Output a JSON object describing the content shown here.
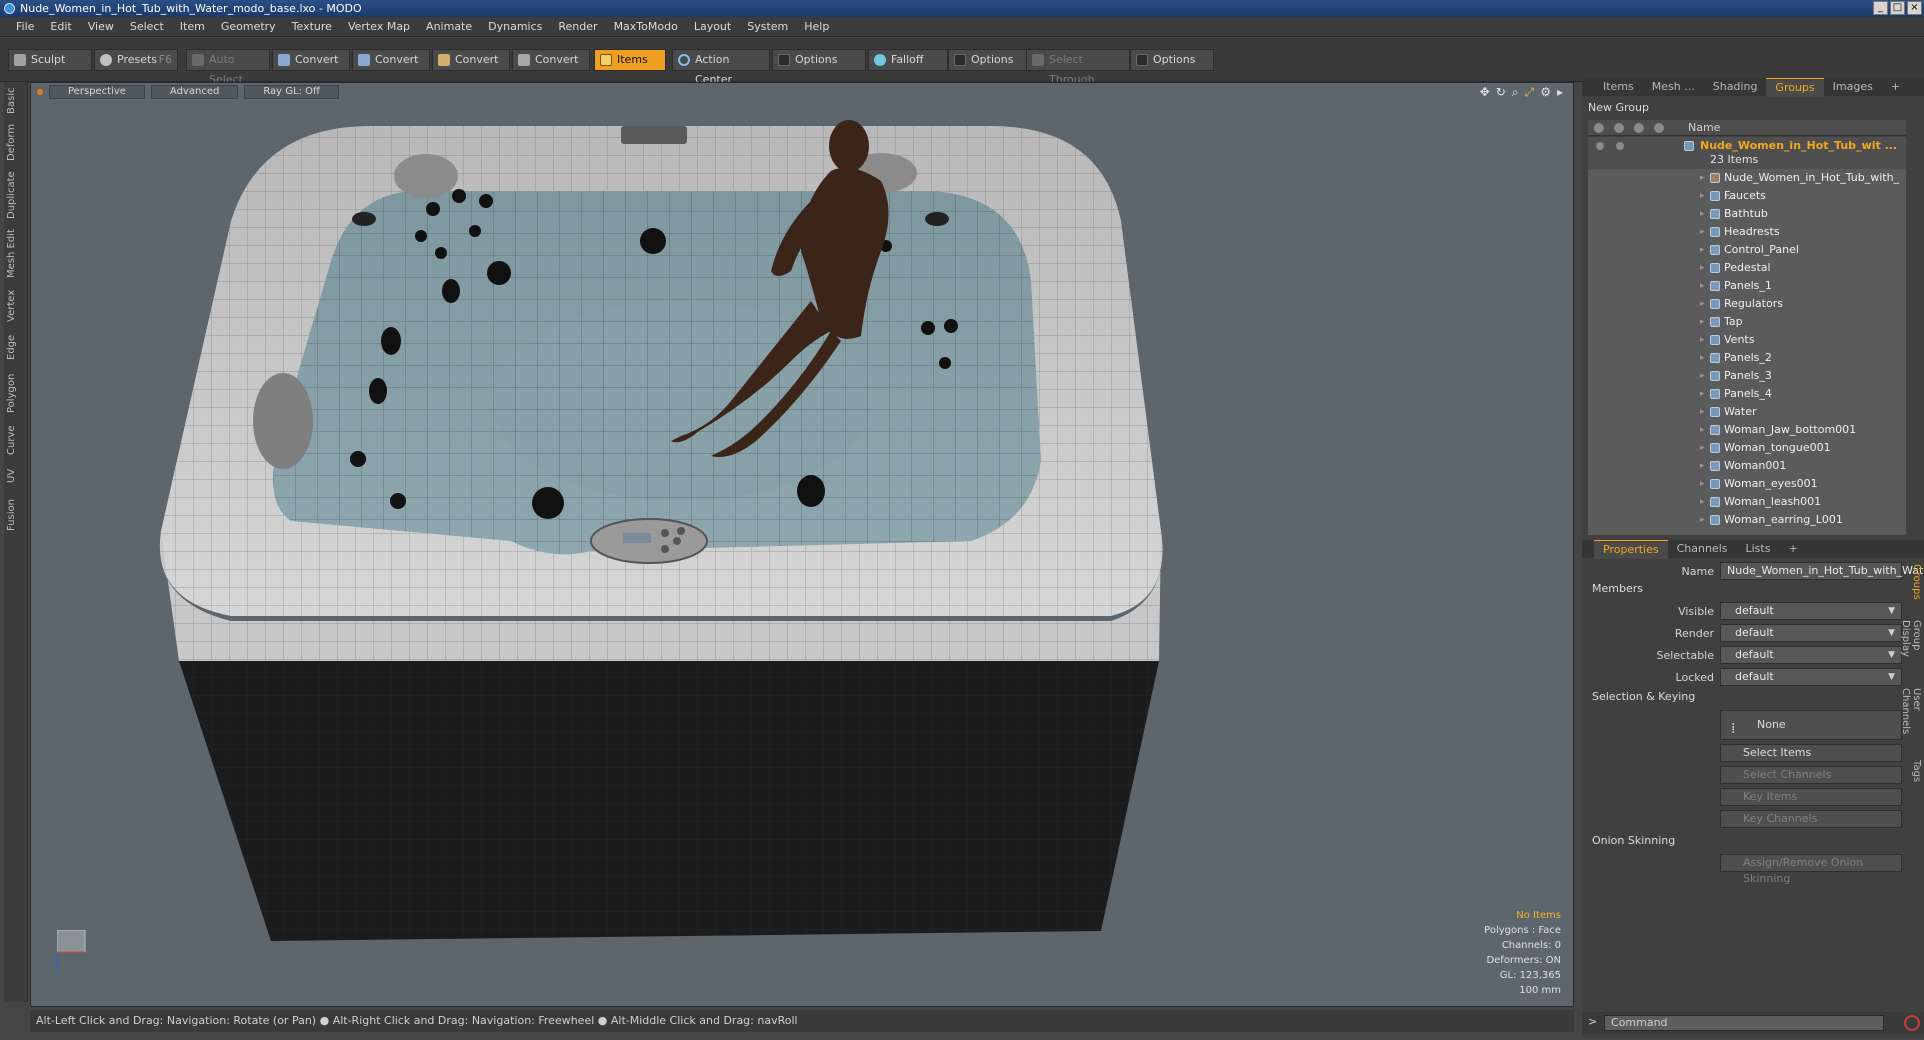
{
  "window": {
    "title": "Nude_Women_in_Hot_Tub_with_Water_modo_base.lxo - MODO"
  },
  "menu": [
    "File",
    "Edit",
    "View",
    "Select",
    "Item",
    "Geometry",
    "Texture",
    "Vertex Map",
    "Animate",
    "Dynamics",
    "Render",
    "MaxToModo",
    "Layout",
    "System",
    "Help"
  ],
  "toolbar": {
    "sculpt": "Sculpt",
    "presets": "Presets",
    "presets_key": "F6",
    "auto_select": "Auto Select",
    "convert1": "Convert",
    "convert2": "Convert",
    "convert3": "Convert",
    "convert4": "Convert",
    "items": "Items",
    "action_center": "Action Center",
    "options1": "Options",
    "falloff": "Falloff",
    "options2": "Options",
    "select_through": "Select Through",
    "options3": "Options"
  },
  "left_tabs": [
    "Basic",
    "Deform",
    "Duplicate",
    "Mesh Edit",
    "Vertex",
    "Edge",
    "Polygon",
    "Curve",
    "UV",
    "Fusion"
  ],
  "viewport": {
    "view": "Perspective",
    "shading": "Advanced",
    "raygl": "Ray GL: Off",
    "stats": {
      "selection": "No Items",
      "polygons": "Polygons : Face",
      "channels": "Channels: 0",
      "deformers": "Deformers: ON",
      "gl": "GL: 123,365",
      "scale": "100 mm"
    }
  },
  "status": "Alt-Left Click and Drag: Navigation: Rotate (or Pan) ● Alt-Right Click and Drag: Navigation: Freewheel ● Alt-Middle Click and Drag: navRoll",
  "top_tabs": [
    "Items",
    "Mesh ...",
    "Shading",
    "Groups",
    "Images"
  ],
  "groups": {
    "new_group": "New Group",
    "header_name": "Name",
    "root": "Nude_Women_in_Hot_Tub_wit ...",
    "root_count": "23 Items",
    "items": [
      "Nude_Women_in_Hot_Tub_with_ ...",
      "Faucets",
      "Bathtub",
      "Headrests",
      "Control_Panel",
      "Pedestal",
      "Panels_1",
      "Regulators",
      "Tap",
      "Vents",
      "Panels_2",
      "Panels_3",
      "Panels_4",
      "Water",
      "Woman_Jaw_bottom001",
      "Woman_tongue001",
      "Woman001",
      "Woman_eyes001",
      "Woman_leash001",
      "Woman_earring_L001"
    ]
  },
  "bottom_tabs": [
    "Properties",
    "Channels",
    "Lists"
  ],
  "properties": {
    "name_label": "Name",
    "name_value": "Nude_Women_in_Hot_Tub_with_Wat",
    "members": "Members",
    "visible_label": "Visible",
    "visible_value": "default",
    "render_label": "Render",
    "render_value": "default",
    "selectable_label": "Selectable",
    "selectable_value": "default",
    "locked_label": "Locked",
    "locked_value": "default",
    "selection_keying": "Selection & Keying",
    "none": "None",
    "select_items": "Select Items",
    "select_channels": "Select Channels",
    "key_items": "Key Items",
    "key_channels": "Key Channels",
    "onion": "Onion Skinning",
    "assign_onion": "Assign/Remove Onion Skinning"
  },
  "right_side_tabs": [
    "Groups",
    "Group Display",
    "User Channels",
    "Tags"
  ],
  "command": {
    "placeholder": "Command"
  },
  "colors": {
    "accent": "#f2a81f",
    "selected_text": "#f2a81f"
  }
}
